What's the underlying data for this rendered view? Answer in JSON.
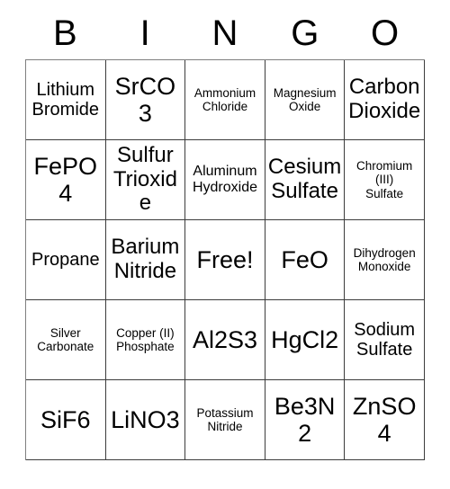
{
  "card": {
    "header_letters": [
      "B",
      "I",
      "N",
      "G",
      "O"
    ],
    "grid": {
      "rows": 5,
      "columns": 5,
      "border_color": "#3c3c3c",
      "background_color": "#ffffff",
      "text_color": "#000000"
    },
    "cells": [
      [
        {
          "text": "Lithium\nBromide",
          "size": "md",
          "free": false
        },
        {
          "text": "SrCO3",
          "size": "xl",
          "free": false
        },
        {
          "text": "Ammonium\nChloride",
          "size": "xs",
          "free": false
        },
        {
          "text": "Magnesium\nOxide",
          "size": "xs",
          "free": false
        },
        {
          "text": "Carbon\nDioxide",
          "size": "lg",
          "free": false
        }
      ],
      [
        {
          "text": "FePO4",
          "size": "xl",
          "free": false
        },
        {
          "text": "Sulfur\nTrioxide",
          "size": "lg",
          "free": false
        },
        {
          "text": "Aluminum\nHydroxide",
          "size": "sm",
          "free": false
        },
        {
          "text": "Cesium\nSulfate",
          "size": "lg",
          "free": false
        },
        {
          "text": "Chromium\n(III)\nSulfate",
          "size": "xs",
          "free": false
        }
      ],
      [
        {
          "text": "Propane",
          "size": "md",
          "free": false
        },
        {
          "text": "Barium\nNitride",
          "size": "lg",
          "free": false
        },
        {
          "text": "Free!",
          "size": "xl",
          "free": true
        },
        {
          "text": "FeO",
          "size": "xl",
          "free": false
        },
        {
          "text": "Dihydrogen\nMonoxide",
          "size": "xs",
          "free": false
        }
      ],
      [
        {
          "text": "Silver\nCarbonate",
          "size": "xs",
          "free": false
        },
        {
          "text": "Copper (II)\nPhosphate",
          "size": "xs",
          "free": false
        },
        {
          "text": "Al2S3",
          "size": "xl",
          "free": false
        },
        {
          "text": "HgCl2",
          "size": "xl",
          "free": false
        },
        {
          "text": "Sodium\nSulfate",
          "size": "md",
          "free": false
        }
      ],
      [
        {
          "text": "SiF6",
          "size": "xl",
          "free": false
        },
        {
          "text": "LiNO3",
          "size": "xl",
          "free": false
        },
        {
          "text": "Potassium\nNitride",
          "size": "xs",
          "free": false
        },
        {
          "text": "Be3N2",
          "size": "xl",
          "free": false
        },
        {
          "text": "ZnSO4",
          "size": "xl",
          "free": false
        }
      ]
    ]
  }
}
